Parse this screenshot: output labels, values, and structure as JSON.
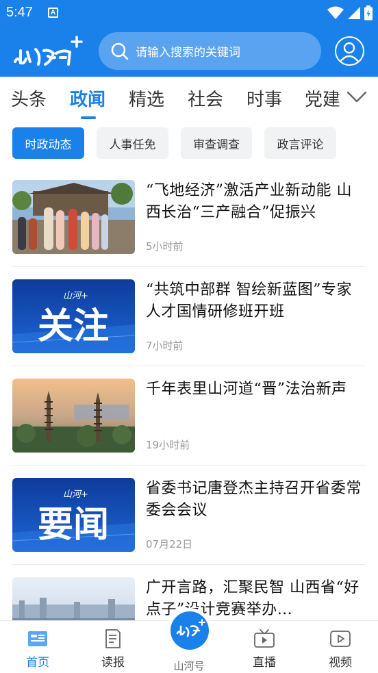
{
  "status_bar": {
    "time": "5:47",
    "icons": [
      "a-icon",
      "wifi-icon",
      "signal-icon",
      "battery-icon"
    ]
  },
  "header": {
    "logo_icon": "shanhe-plus-logo",
    "search_placeholder": "请输入搜索的关键词",
    "avatar_icon": "user-icon",
    "brand_color": "#1a80ea"
  },
  "tabs": {
    "items": [
      {
        "label": "头条",
        "active": false
      },
      {
        "label": "政闻",
        "active": true
      },
      {
        "label": "精选",
        "active": false
      },
      {
        "label": "社会",
        "active": false
      },
      {
        "label": "时事",
        "active": false
      },
      {
        "label": "党建",
        "active": false
      }
    ],
    "more_icon": "chevron-down-icon"
  },
  "chips": {
    "items": [
      {
        "label": "时政动态",
        "active": true
      },
      {
        "label": "人事任免",
        "active": false
      },
      {
        "label": "审查调查",
        "active": false
      },
      {
        "label": "政言评论",
        "active": false
      }
    ]
  },
  "news": {
    "items": [
      {
        "title": "“飞地经济”激活产业新动能 山西长治“三产融合”促振兴",
        "time": "5小时前",
        "thumb": "festival-photo"
      },
      {
        "title": "“共筑中部群 智绘新蓝图”专家人才国情研修班开班",
        "time": "7小时前",
        "thumb": "guanzhu-banner",
        "thumb_text": "关注",
        "thumb_logo": "山河+"
      },
      {
        "title": "千年表里山河道“晋”法治新声",
        "time": "19小时前",
        "thumb": "twin-pagoda-photo"
      },
      {
        "title": "省委书记唐登杰主持召开省委常委会会议",
        "time": "07月22日",
        "thumb": "yaowen-banner",
        "thumb_text": "要闻",
        "thumb_logo": "山河+"
      },
      {
        "title": "广开言路，汇聚民智 山西省“好点子”设计竞赛举办…",
        "time": "",
        "thumb": "city-skyline-photo"
      }
    ]
  },
  "bottom_nav": {
    "items": [
      {
        "label": "首页",
        "icon": "home-news-icon",
        "active": true
      },
      {
        "label": "读报",
        "icon": "newspaper-icon",
        "active": false
      },
      {
        "label": "山河号",
        "icon": "shanhe-logo-icon",
        "active": false
      },
      {
        "label": "直播",
        "icon": "tv-live-icon",
        "active": false
      },
      {
        "label": "视频",
        "icon": "video-play-icon",
        "active": false
      }
    ]
  }
}
